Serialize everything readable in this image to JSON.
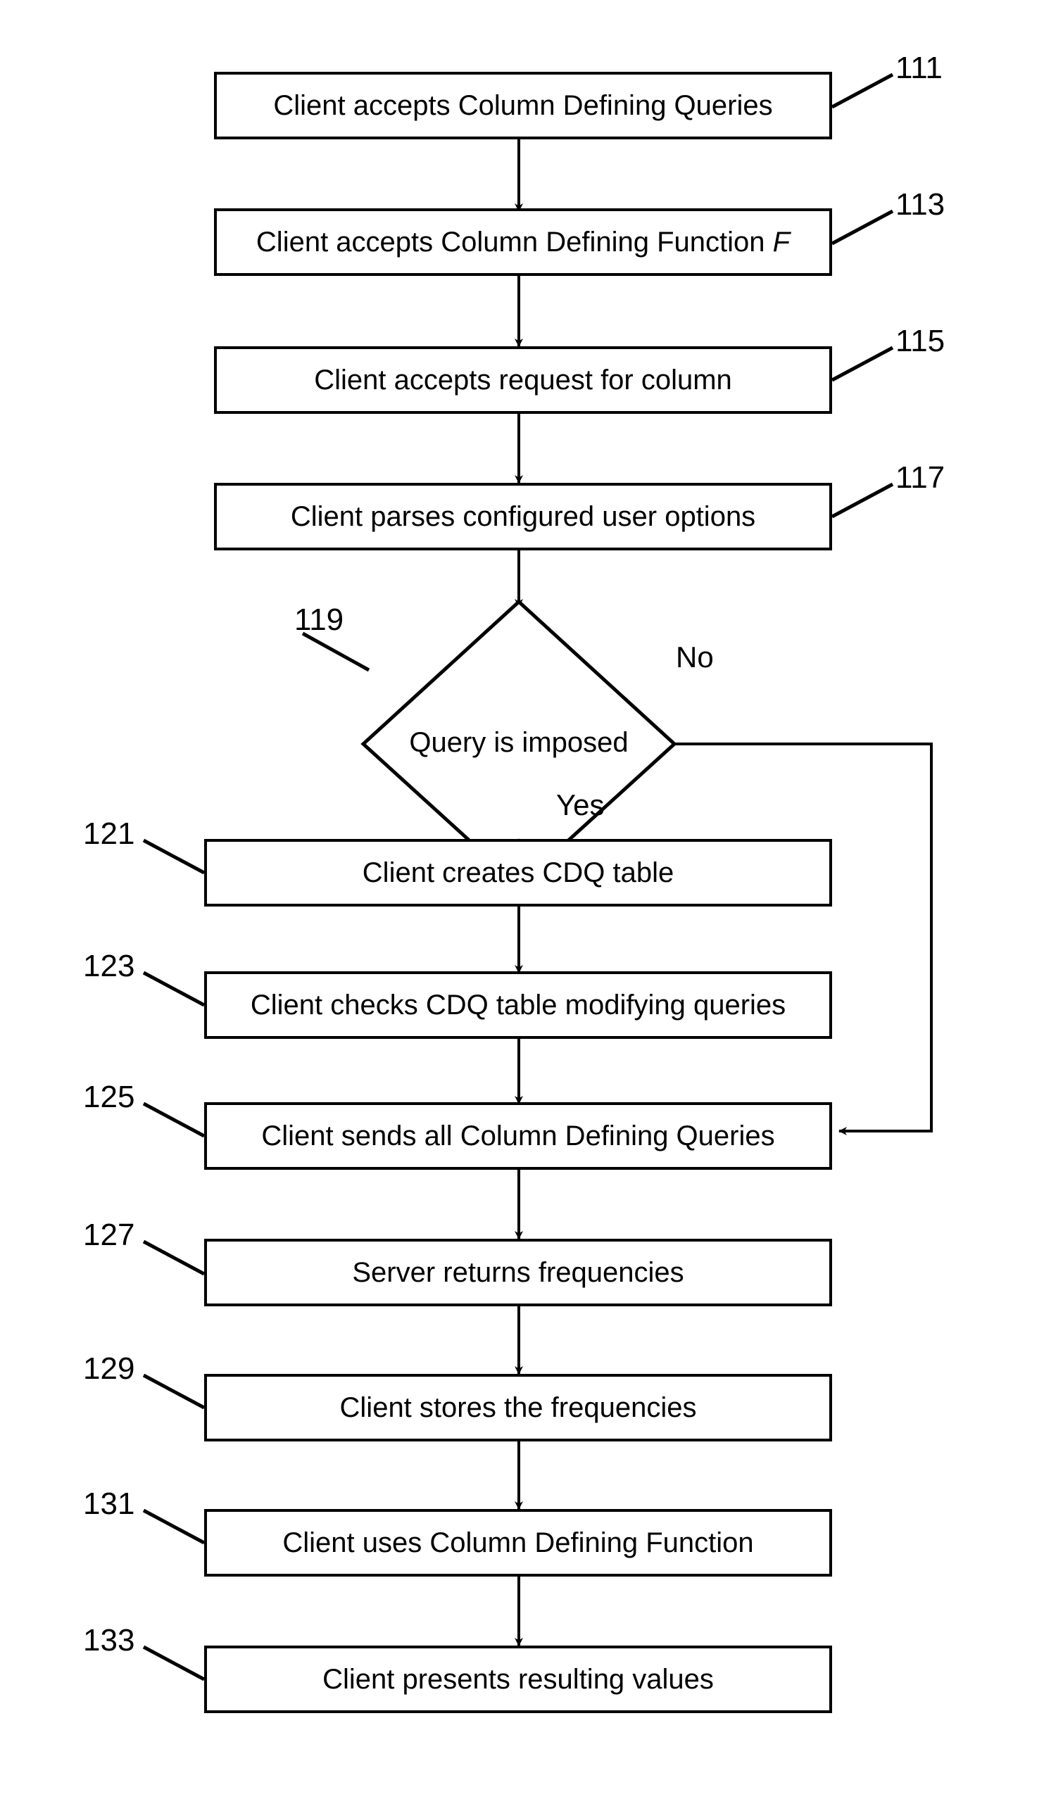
{
  "diagram": {
    "kind": "patent-flowchart",
    "title": "Column Defining Query client process flowchart",
    "stroke_color": "#000000",
    "background_color": "#ffffff"
  },
  "nodes": [
    {
      "ref": "111",
      "shape": "process",
      "text": "Client accepts Column Defining Queries",
      "italic_suffix": ""
    },
    {
      "ref": "113",
      "shape": "process",
      "text": "Client accepts Column Defining Function ",
      "italic_suffix": "F"
    },
    {
      "ref": "115",
      "shape": "process",
      "text": "Client accepts request for column",
      "italic_suffix": ""
    },
    {
      "ref": "117",
      "shape": "process",
      "text": "Client parses configured user options",
      "italic_suffix": ""
    },
    {
      "ref": "119",
      "shape": "decision",
      "text": "Query is imposed",
      "italic_suffix": ""
    },
    {
      "ref": "121",
      "shape": "process",
      "text": "Client creates CDQ table",
      "italic_suffix": ""
    },
    {
      "ref": "123",
      "shape": "process",
      "text": "Client checks CDQ table modifying queries",
      "italic_suffix": ""
    },
    {
      "ref": "125",
      "shape": "process",
      "text": "Client sends all Column Defining Queries",
      "italic_suffix": ""
    },
    {
      "ref": "127",
      "shape": "process",
      "text": "Server returns frequencies",
      "italic_suffix": ""
    },
    {
      "ref": "129",
      "shape": "process",
      "text": "Client stores the frequencies",
      "italic_suffix": ""
    },
    {
      "ref": "131",
      "shape": "process",
      "text": "Client uses Column Defining Function",
      "italic_suffix": ""
    },
    {
      "ref": "133",
      "shape": "process",
      "text": "Client presents resulting values",
      "italic_suffix": ""
    }
  ],
  "branch_labels": {
    "no": "No",
    "yes": "Yes"
  }
}
